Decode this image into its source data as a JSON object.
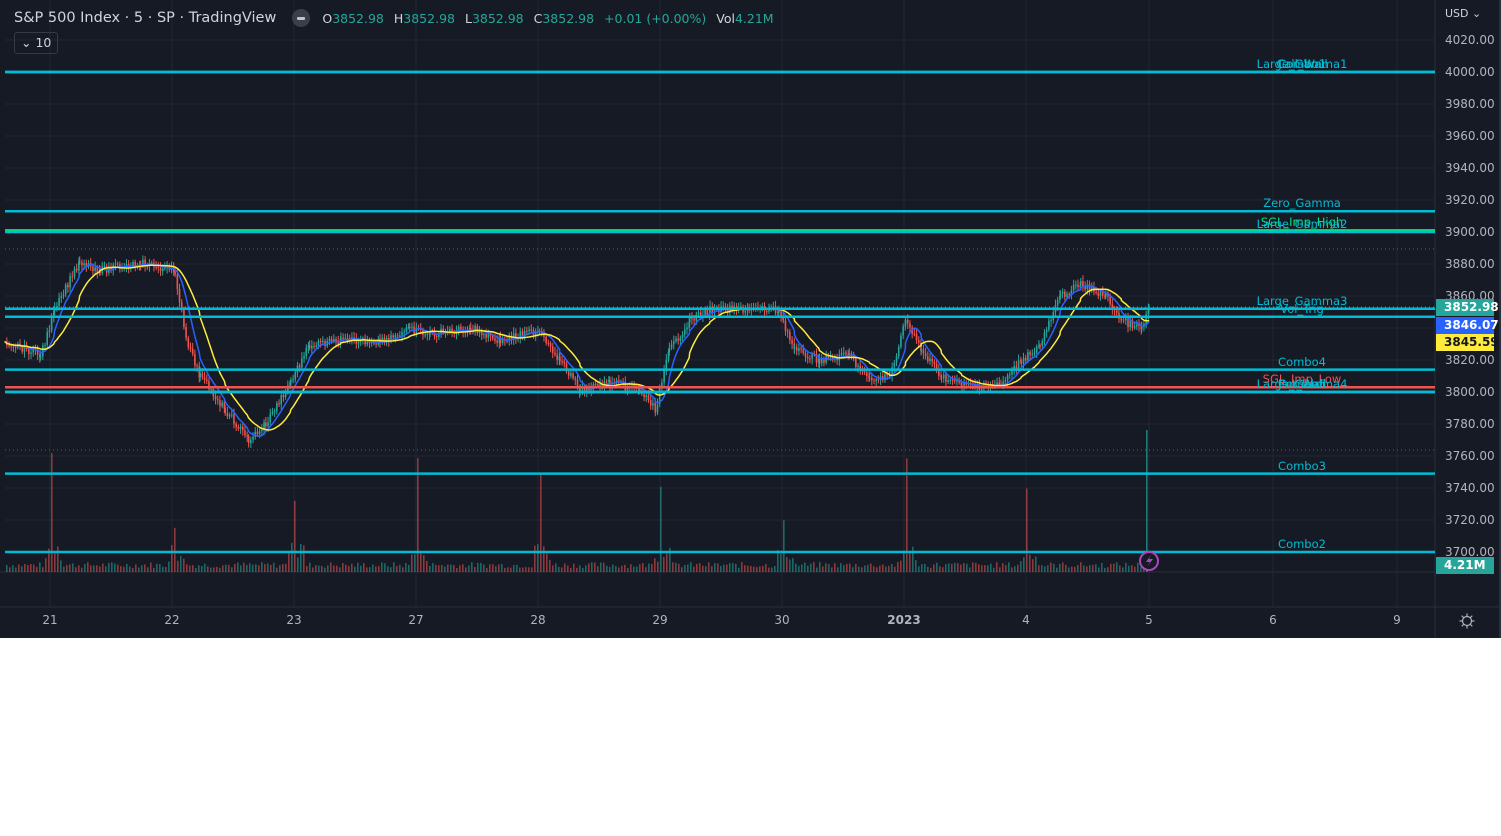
{
  "header": {
    "title": "S&P 500 Index · 5 · SP  · TradingView",
    "ohlc": [
      {
        "label": "O",
        "value": "3852.98"
      },
      {
        "label": "H",
        "value": "3852.98"
      },
      {
        "label": "L",
        "value": "3852.98"
      },
      {
        "label": "C",
        "value": "3852.98"
      }
    ],
    "change": "+0.01 (+0.00%)",
    "vol_label": "Vol",
    "vol_value": "4.21M",
    "indicators_collapse": "10",
    "currency": "USD"
  },
  "colors": {
    "background": "#161a25",
    "up": "#26a69a",
    "down": "#ef5350",
    "level_line": "#00bcd4",
    "level_green": "#00e676",
    "level_red": "#ef5350",
    "ma_fast": "#2962ff",
    "ma_slow": "#ffeb3b"
  },
  "price_axis": {
    "ticks": [
      "4020.00",
      "4000.00",
      "3980.00",
      "3960.00",
      "3940.00",
      "3920.00",
      "3900.00",
      "3880.00",
      "3860.00",
      "3840.00",
      "3820.00",
      "3800.00",
      "3780.00",
      "3760.00",
      "3740.00",
      "3720.00",
      "3700.00"
    ],
    "badges": [
      {
        "name": "last-price",
        "value": "3852.98",
        "bg": "#26a69a",
        "fg": "#ffffff"
      },
      {
        "name": "ma-fast",
        "value": "3846.07",
        "bg": "#2962ff",
        "fg": "#ffffff"
      },
      {
        "name": "ma-slow",
        "value": "3845.59",
        "bg": "#ffeb3b",
        "fg": "#131722"
      },
      {
        "name": "volume",
        "value": "4.21M",
        "bg": "#26a69a",
        "fg": "#ffffff"
      }
    ]
  },
  "time_axis": {
    "ticks": [
      "21",
      "22",
      "23",
      "27",
      "28",
      "29",
      "30",
      "2023",
      "4",
      "5",
      "6",
      "9"
    ]
  },
  "levels": [
    {
      "label": "Large_Gamma1",
      "price": 4000,
      "color": "#00bcd4"
    },
    {
      "label": "Call_Wall",
      "price": 4000,
      "color": "#00bcd4"
    },
    {
      "label": "Combo1",
      "price": 4000,
      "color": "#00bcd4"
    },
    {
      "label": "Zero_Gamma",
      "price": 3913,
      "color": "#00bcd4"
    },
    {
      "label": "SGL_Imp_High",
      "price": 3901,
      "color": "#00e676"
    },
    {
      "label": "Large_Gamma2",
      "price": 3900,
      "color": "#00bcd4"
    },
    {
      "label": "Large_Gamma3",
      "price": 3852,
      "color": "#00bcd4"
    },
    {
      "label": "Vol_Trig",
      "price": 3847,
      "color": "#00bcd4"
    },
    {
      "label": "Combo4",
      "price": 3814,
      "color": "#00bcd4"
    },
    {
      "label": "SGL_Imp_Low",
      "price": 3803,
      "color": "#ef5350"
    },
    {
      "label": "Large_Gamma4",
      "price": 3800,
      "color": "#00bcd4"
    },
    {
      "label": "Put_Wall",
      "price": 3800,
      "color": "#00bcd4"
    },
    {
      "label": "Combo5",
      "price": 3800,
      "color": "#00bcd4"
    },
    {
      "label": "Combo3",
      "price": 3749,
      "color": "#00bcd4"
    },
    {
      "label": "Combo2",
      "price": 3700,
      "color": "#00bcd4"
    }
  ],
  "chart_data": {
    "type": "line",
    "ylim": [
      3690,
      4025
    ],
    "grid": true,
    "series": [
      {
        "points": [
          [
            "2022-12-20 13:35",
            3832
          ],
          [
            "2022-12-20 15:30",
            3823
          ],
          [
            "2022-12-21 09:45",
            3851
          ],
          [
            "2022-12-21 11:05",
            3882
          ],
          [
            "2022-12-21 12:10",
            3876
          ],
          [
            "2022-12-21 14:20",
            3881
          ],
          [
            "2022-12-22 09:40",
            3875
          ],
          [
            "2022-12-22 10:15",
            3832
          ],
          [
            "2022-12-22 11:00",
            3810
          ],
          [
            "2022-12-22 12:20",
            3789
          ],
          [
            "2022-12-22 13:35",
            3770
          ],
          [
            "2022-12-22 14:30",
            3780
          ],
          [
            "2022-12-22 15:50",
            3807
          ],
          [
            "2022-12-23 10:20",
            3829
          ],
          [
            "2022-12-23 12:00",
            3832
          ],
          [
            "2022-12-23 14:05",
            3832
          ],
          [
            "2022-12-23 15:40",
            3839
          ],
          [
            "2022-12-27 10:15",
            3836
          ],
          [
            "2022-12-27 12:25",
            3840
          ],
          [
            "2022-12-27 14:00",
            3832
          ],
          [
            "2022-12-28 09:35",
            3839
          ],
          [
            "2022-12-28 10:40",
            3820
          ],
          [
            "2022-12-28 11:45",
            3801
          ],
          [
            "2022-12-28 13:20",
            3806
          ],
          [
            "2022-12-28 14:55",
            3801
          ],
          [
            "2022-12-28 15:45",
            3789
          ],
          [
            "2022-12-29 10:00",
            3826
          ],
          [
            "2022-12-29 11:05",
            3845
          ],
          [
            "2022-12-29 12:10",
            3851
          ],
          [
            "2022-12-29 14:15",
            3852
          ],
          [
            "2022-12-29 15:50",
            3851
          ],
          [
            "2022-12-30 10:10",
            3826
          ],
          [
            "2022-12-30 11:30",
            3820
          ],
          [
            "2022-12-30 13:05",
            3823
          ],
          [
            "2022-12-30 14:10",
            3807
          ],
          [
            "2022-12-30 15:15",
            3810
          ],
          [
            "2023-01-03 09:35",
            3845
          ],
          [
            "2023-01-03 10:25",
            3826
          ],
          [
            "2023-01-03 11:30",
            3810
          ],
          [
            "2023-01-03 12:35",
            3804
          ],
          [
            "2023-01-03 14:40",
            3804
          ],
          [
            "2023-01-03 15:45",
            3820
          ],
          [
            "2023-01-04 10:15",
            3829
          ],
          [
            "2023-01-04 11:20",
            3860
          ],
          [
            "2023-01-04 12:25",
            3867
          ],
          [
            "2023-01-04 13:45",
            3860
          ],
          [
            "2023-01-04 14:35",
            3845
          ],
          [
            "2023-01-04 15:40",
            3839
          ],
          [
            "2023-01-05 09:30",
            3853
          ]
        ]
      }
    ]
  }
}
